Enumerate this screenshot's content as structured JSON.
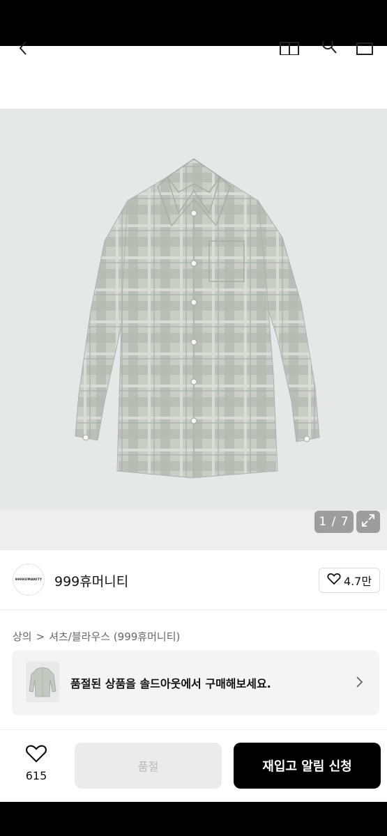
{
  "header": {
    "back_icon": "chevron-left-icon",
    "home_icon": "home-icon",
    "search_icon": "search-icon",
    "cart_icon": "cart-icon"
  },
  "gallery": {
    "counter": "1 / 7",
    "expand_icon": "expand-icon",
    "image_subject": "plaid-shirt"
  },
  "brand": {
    "logo_text": "999HUMANITY",
    "name": "999휴머니티",
    "like_count": "4.7만"
  },
  "breadcrumb": {
    "level1": "상의",
    "separator": ">",
    "level2": "셔츠/블라우스 (999휴머니티)"
  },
  "soldout_banner": {
    "text": "품절된 상품을 솔드아웃에서 구매해보세요."
  },
  "bottom_bar": {
    "wish_count": "615",
    "soldout_label": "품절",
    "restock_label": "재입고 알림 신청"
  },
  "colors": {
    "primary_button": "#000000",
    "disabled_button": "#ebebeb",
    "gallery_bg": "#e6e7e7"
  }
}
